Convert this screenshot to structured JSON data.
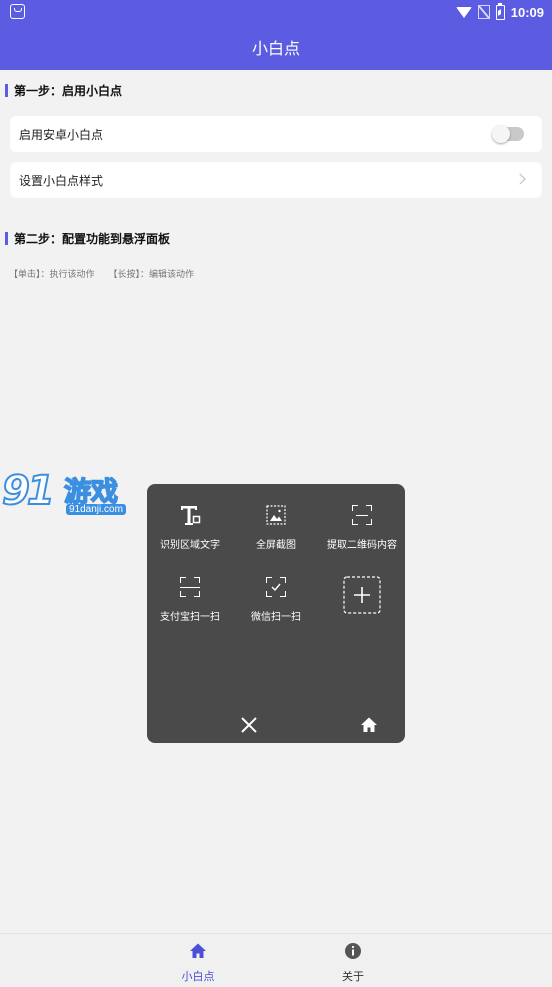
{
  "status_bar": {
    "time": "10:09"
  },
  "app_bar": {
    "title": "小白点"
  },
  "step1": {
    "heading": "第一步：启用小白点",
    "enable_label": "启用安卓小白点",
    "enable_on": false,
    "style_label": "设置小白点样式"
  },
  "step2": {
    "heading": "第二步：配置功能到悬浮面板",
    "hint_click": "【单击】：执行该动作",
    "hint_long": "【长按】：编辑该动作"
  },
  "watermark": {
    "brand": "91",
    "name": "游戏",
    "url": "91danji.com"
  },
  "panel": {
    "items": [
      {
        "label": "识别区域文字",
        "icon": "text-recognize-icon"
      },
      {
        "label": "全屏截图",
        "icon": "screenshot-icon"
      },
      {
        "label": "提取二维码内容",
        "icon": "qr-scan-icon"
      },
      {
        "label": "支付宝扫一扫",
        "icon": "alipay-scan-icon"
      },
      {
        "label": "微信扫一扫",
        "icon": "wechat-scan-icon"
      },
      {
        "label": "",
        "icon": "add-icon"
      }
    ],
    "close_icon": "close-icon",
    "home_icon": "home-icon"
  },
  "bottom_nav": {
    "items": [
      {
        "label": "小白点",
        "icon": "home-icon",
        "active": true
      },
      {
        "label": "关于",
        "icon": "info-icon",
        "active": false
      }
    ]
  },
  "colors": {
    "primary": "#5b5ce2",
    "panel": "#4a4a4a",
    "background": "#f2f2f2"
  }
}
